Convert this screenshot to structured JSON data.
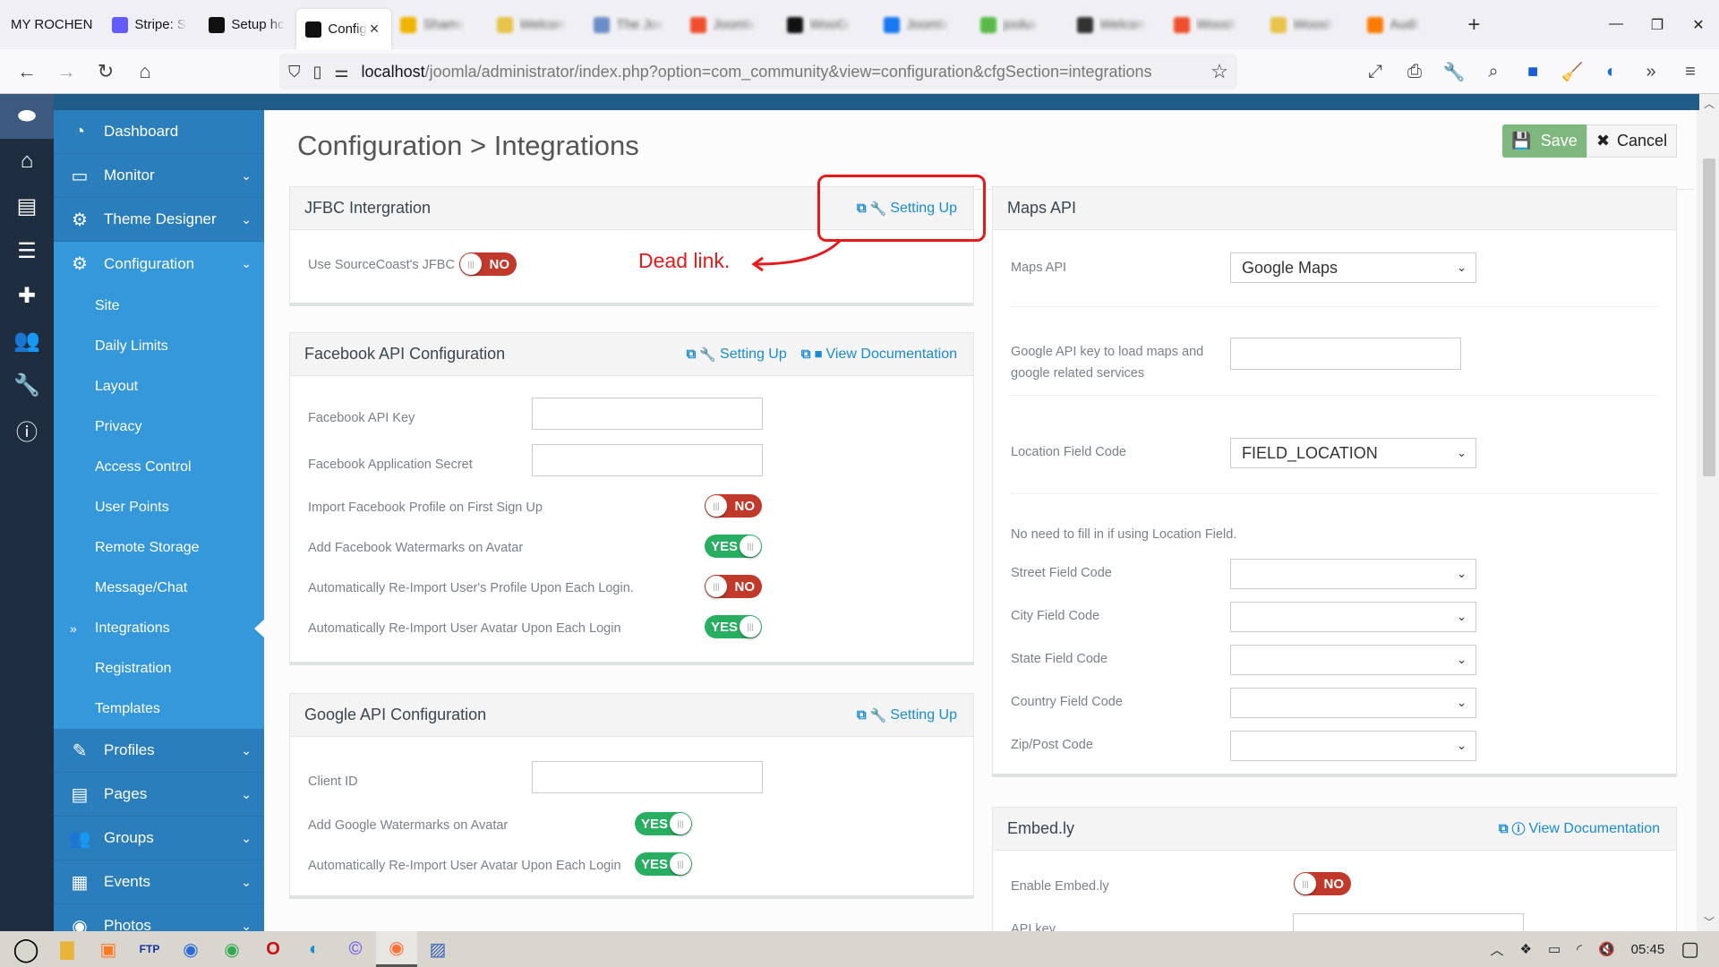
{
  "browser": {
    "bookmark_label": "MY ROCHEN",
    "tabs": [
      {
        "label": "Stripe: S",
        "icon": "stripe-icon",
        "color": "#635bff",
        "active": false,
        "blurred": false
      },
      {
        "label": "Setup hc",
        "icon": "joomla-icon",
        "color": "#111111",
        "active": false,
        "blurred": false
      },
      {
        "label": "Config",
        "icon": "joomla-icon",
        "color": "#111111",
        "active": true,
        "blurred": false
      },
      {
        "label": "Shamo",
        "icon": "star-favicon",
        "color": "#f0b400",
        "blurred": true
      },
      {
        "label": "Welcom",
        "icon": "yellow-favicon",
        "color": "#e7c44a",
        "blurred": true
      },
      {
        "label": "The Joo",
        "icon": "blue-favicon",
        "color": "#6b8fc8",
        "blurred": true
      },
      {
        "label": "Joomla",
        "icon": "joomla-color-icon",
        "color": "#f04f2d",
        "blurred": true
      },
      {
        "label": "WooGr",
        "icon": "joomla-icon",
        "color": "#111111",
        "blurred": true
      },
      {
        "label": "Joomla",
        "icon": "facebook-icon",
        "color": "#1877f2",
        "blurred": true
      },
      {
        "label": "joolux",
        "icon": "joomla-color-icon",
        "color": "#58b947",
        "blurred": true
      },
      {
        "label": "Welcom",
        "icon": "p-icon",
        "color": "#333333",
        "blurred": true
      },
      {
        "label": "Woosh",
        "icon": "joomla-color-icon",
        "color": "#f04f2d",
        "blurred": true
      },
      {
        "label": "Woosh",
        "icon": "yellow-favicon",
        "color": "#e7c44a",
        "blurred": true
      },
      {
        "label": "Audit",
        "icon": "a-icon",
        "color": "#ff7a00",
        "blurred": true
      }
    ],
    "tab_close": "×",
    "new_tab": "+",
    "window_controls": {
      "minimize": "—",
      "restore": "❐",
      "close": "✕"
    },
    "nav": {
      "back": "←",
      "forward": "→",
      "reload": "↻",
      "home": "⌂"
    },
    "url_host": "localhost",
    "url_path": "/joomla/administrator/index.php?option=com_community&view=configuration&cfgSection=integrations",
    "toolbar_icons": [
      "fullscreen-icon",
      "print-icon",
      "wrench-icon",
      "search-icon",
      "bitwarden-icon",
      "broom-icon",
      "extension-icon",
      "overflow-icon",
      "menu-icon"
    ]
  },
  "sidebar": {
    "rail_icons": [
      "toggle-icon",
      "home-icon",
      "file-icon",
      "list-icon",
      "puzzle-icon",
      "users-icon",
      "wrench-icon",
      "info-icon"
    ],
    "items": [
      {
        "label": "Dashboard",
        "icon": "dashboard-icon",
        "glyph": "◔",
        "has_children": false
      },
      {
        "label": "Monitor",
        "icon": "monitor-icon",
        "glyph": "▭",
        "has_children": true
      },
      {
        "label": "Theme Designer",
        "icon": "cogs-icon",
        "glyph": "⚙",
        "has_children": true
      },
      {
        "label": "Configuration",
        "icon": "cogs-icon",
        "glyph": "⚙",
        "has_children": true,
        "open": true
      }
    ],
    "sub_items": [
      {
        "label": "Site"
      },
      {
        "label": "Daily Limits"
      },
      {
        "label": "Layout"
      },
      {
        "label": "Privacy"
      },
      {
        "label": "Access Control"
      },
      {
        "label": "User Points"
      },
      {
        "label": "Remote Storage"
      },
      {
        "label": "Message/Chat"
      },
      {
        "label": "Integrations",
        "active": true,
        "marker": "»"
      },
      {
        "label": "Registration"
      },
      {
        "label": "Templates"
      }
    ],
    "items_after": [
      {
        "label": "Profiles",
        "icon": "edit-icon",
        "glyph": "✎"
      },
      {
        "label": "Pages",
        "icon": "pages-icon",
        "glyph": "▤"
      },
      {
        "label": "Groups",
        "icon": "groups-icon",
        "glyph": "👥"
      },
      {
        "label": "Events",
        "icon": "calendar-icon",
        "glyph": "▦"
      },
      {
        "label": "Photos",
        "icon": "camera-icon",
        "glyph": "◉"
      }
    ]
  },
  "page": {
    "title": "Configuration > Integrations",
    "save_label": "Save",
    "cancel_label": "Cancel"
  },
  "jfbc": {
    "title": "JFBC Intergration",
    "setting_up": "Setting Up",
    "rows": [
      {
        "label": "Use SourceCoast's JFBC",
        "value": "NO"
      }
    ]
  },
  "annotation": {
    "text": "Dead link.",
    "color": "#e41b1b"
  },
  "facebook": {
    "title": "Facebook API Configuration",
    "setting_up": "Setting Up",
    "view_docs": "View Documentation",
    "fields": [
      {
        "label": "Facebook API Key",
        "value": ""
      },
      {
        "label": "Facebook Application Secret",
        "value": ""
      }
    ],
    "toggles": [
      {
        "label": "Import Facebook Profile on First Sign Up",
        "value": "NO"
      },
      {
        "label": "Add Facebook Watermarks on Avatar",
        "value": "YES"
      },
      {
        "label": "Automatically Re-Import User's Profile Upon Each Login.",
        "value": "NO"
      },
      {
        "label": "Automatically Re-Import User Avatar Upon Each Login",
        "value": "YES"
      }
    ]
  },
  "google": {
    "title": "Google API Configuration",
    "setting_up": "Setting Up",
    "fields": [
      {
        "label": "Client ID",
        "value": ""
      }
    ],
    "toggles": [
      {
        "label": "Add Google Watermarks on Avatar",
        "value": "YES"
      },
      {
        "label": "Automatically Re-Import User Avatar Upon Each Login",
        "value": "YES"
      }
    ]
  },
  "maps": {
    "title": "Maps API",
    "maps_api_label": "Maps API",
    "maps_api_value": "Google Maps",
    "google_key_label_1": "Google API key to load maps and",
    "google_key_label_2": "google related services",
    "google_key_value": "",
    "location_label": "Location Field Code",
    "location_value": "FIELD_LOCATION",
    "note": "No need to fill in if using Location Field.",
    "selects": [
      {
        "label": "Street Field Code",
        "value": ""
      },
      {
        "label": "City Field Code",
        "value": ""
      },
      {
        "label": "State Field Code",
        "value": ""
      },
      {
        "label": "Country Field Code",
        "value": ""
      },
      {
        "label": "Zip/Post Code",
        "value": ""
      }
    ]
  },
  "embedly": {
    "title": "Embed.ly",
    "view_docs": "View Documentation",
    "enable_label": "Enable Embed.ly",
    "enable_value": "NO",
    "api_key_label": "API key",
    "api_key_value": ""
  },
  "toggle_colors": {
    "yes": "#27ae60",
    "no": "#c0392b"
  },
  "link_color": "#1a8bd1",
  "taskbar": {
    "icons": [
      "start-icon",
      "file-explorer-icon",
      "xampp-icon",
      "ftp-icon",
      "thunderbird-icon",
      "chrome-icon",
      "opera-icon",
      "edge-icon",
      "cortana-icon",
      "firefox-icon",
      "remote-desktop-icon"
    ],
    "clock": "05:45",
    "tray_icons": [
      "show-hidden-icon",
      "dropbox-icon",
      "battery-icon",
      "wifi-icon",
      "mute-icon"
    ]
  }
}
